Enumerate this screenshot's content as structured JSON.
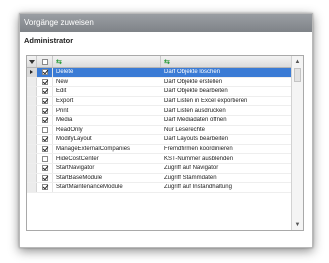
{
  "window": {
    "title": "Vorgänge zuweisen",
    "section": "Administrator"
  },
  "grid": {
    "header_icons": {
      "filter": "filter-icon",
      "select_all": "checkbox-header-icon",
      "col_name": "swap-columns-icon",
      "col_desc": "swap-columns-icon"
    },
    "rows": [
      {
        "checked": true,
        "name": "Delete",
        "desc": "Darf Objekte löschen",
        "selected": true
      },
      {
        "checked": true,
        "name": "New",
        "desc": "Darf Objekte erstellen",
        "selected": false
      },
      {
        "checked": true,
        "name": "Edit",
        "desc": "Darf Objekte bearbeiten",
        "selected": false
      },
      {
        "checked": true,
        "name": "Export",
        "desc": "Darf Listen in Excel exportieren",
        "selected": false
      },
      {
        "checked": true,
        "name": "Print",
        "desc": "Darf Listen ausdrucken",
        "selected": false
      },
      {
        "checked": true,
        "name": "Media",
        "desc": "Darf Mediadaten öffnen",
        "selected": false
      },
      {
        "checked": false,
        "name": "ReadOnly",
        "desc": "Nur Leserechte",
        "selected": false
      },
      {
        "checked": true,
        "name": "ModifyLayout",
        "desc": "Darf Layouts bearbeiten",
        "selected": false
      },
      {
        "checked": true,
        "name": "ManageExternalCompanies",
        "desc": "Fremdfirmen koordinieren",
        "selected": false
      },
      {
        "checked": false,
        "name": "HideCostCenter",
        "desc": "KST-Nummer ausblenden",
        "selected": false
      },
      {
        "checked": true,
        "name": "StartNavigator",
        "desc": "Zugriff auf Navigator",
        "selected": false
      },
      {
        "checked": true,
        "name": "StartBaseModule",
        "desc": "Zugriff Stammdaten",
        "selected": false
      },
      {
        "checked": true,
        "name": "StartMaintenanceModule",
        "desc": "Zugriff auf Instandhaltung",
        "selected": false
      }
    ]
  },
  "colors": {
    "selection": "#3a7bd5",
    "titlebar": "#8a8e93"
  }
}
